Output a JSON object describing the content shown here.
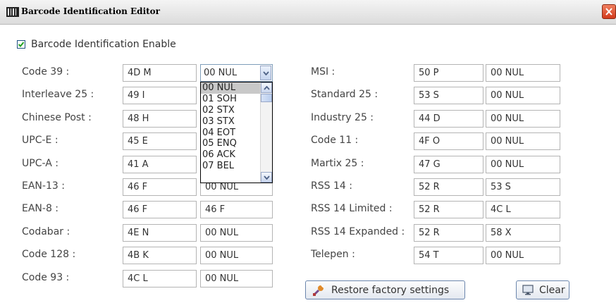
{
  "window": {
    "title": "Barcode Identification Editor"
  },
  "enable": {
    "label": "Barcode Identification Enable",
    "checked": true
  },
  "left_rows": [
    {
      "label": "Code 39 :",
      "value1": "4D M",
      "value2": "00 NUL"
    },
    {
      "label": "Interleave 25 :",
      "value1": "49 I",
      "value2": ""
    },
    {
      "label": "Chinese Post :",
      "value1": "48 H",
      "value2": ""
    },
    {
      "label": "UPC-E :",
      "value1": "45 E",
      "value2": ""
    },
    {
      "label": "UPC-A :",
      "value1": "41 A",
      "value2": ""
    },
    {
      "label": "EAN-13 :",
      "value1": "46 F",
      "value2": "00 NUL"
    },
    {
      "label": "EAN-8 :",
      "value1": "46 F",
      "value2": "46 F"
    },
    {
      "label": "Codabar :",
      "value1": "4E N",
      "value2": "00 NUL"
    },
    {
      "label": "Code 128 :",
      "value1": "4B K",
      "value2": "00 NUL"
    },
    {
      "label": "Code 93 :",
      "value1": "4C L",
      "value2": "00 NUL"
    }
  ],
  "right_rows": [
    {
      "label": "MSI :",
      "value1": "50 P",
      "value2": "00 NUL"
    },
    {
      "label": "Standard 25 :",
      "value1": "53 S",
      "value2": "00 NUL"
    },
    {
      "label": "Industry 25 :",
      "value1": "44 D",
      "value2": "00 NUL"
    },
    {
      "label": "Code 11 :",
      "value1": "4F O",
      "value2": "00 NUL"
    },
    {
      "label": "Martix 25 :",
      "value1": "47 G",
      "value2": "00 NUL"
    },
    {
      "label": "RSS 14 :",
      "value1": "52 R",
      "value2": "53 S"
    },
    {
      "label": "RSS 14 Limited :",
      "value1": "52 R",
      "value2": "4C L"
    },
    {
      "label": "RSS 14 Expanded :",
      "value1": "52 R",
      "value2": "58 X"
    },
    {
      "label": "Telepen :",
      "value1": "54 T",
      "value2": "00 NUL"
    }
  ],
  "dropdown": {
    "selected": "00 NUL",
    "options": [
      "00 NUL",
      "01 SOH",
      "02 STX",
      "03 STX",
      "04 EOT",
      "05 ENQ",
      "06 ACK",
      "07 BEL"
    ]
  },
  "buttons": {
    "restore": "Restore factory settings",
    "clear": "Clear"
  },
  "icons": {
    "title": "barcode-icon",
    "close": "close-icon",
    "restore": "tools-icon",
    "clear": "monitor-icon"
  }
}
